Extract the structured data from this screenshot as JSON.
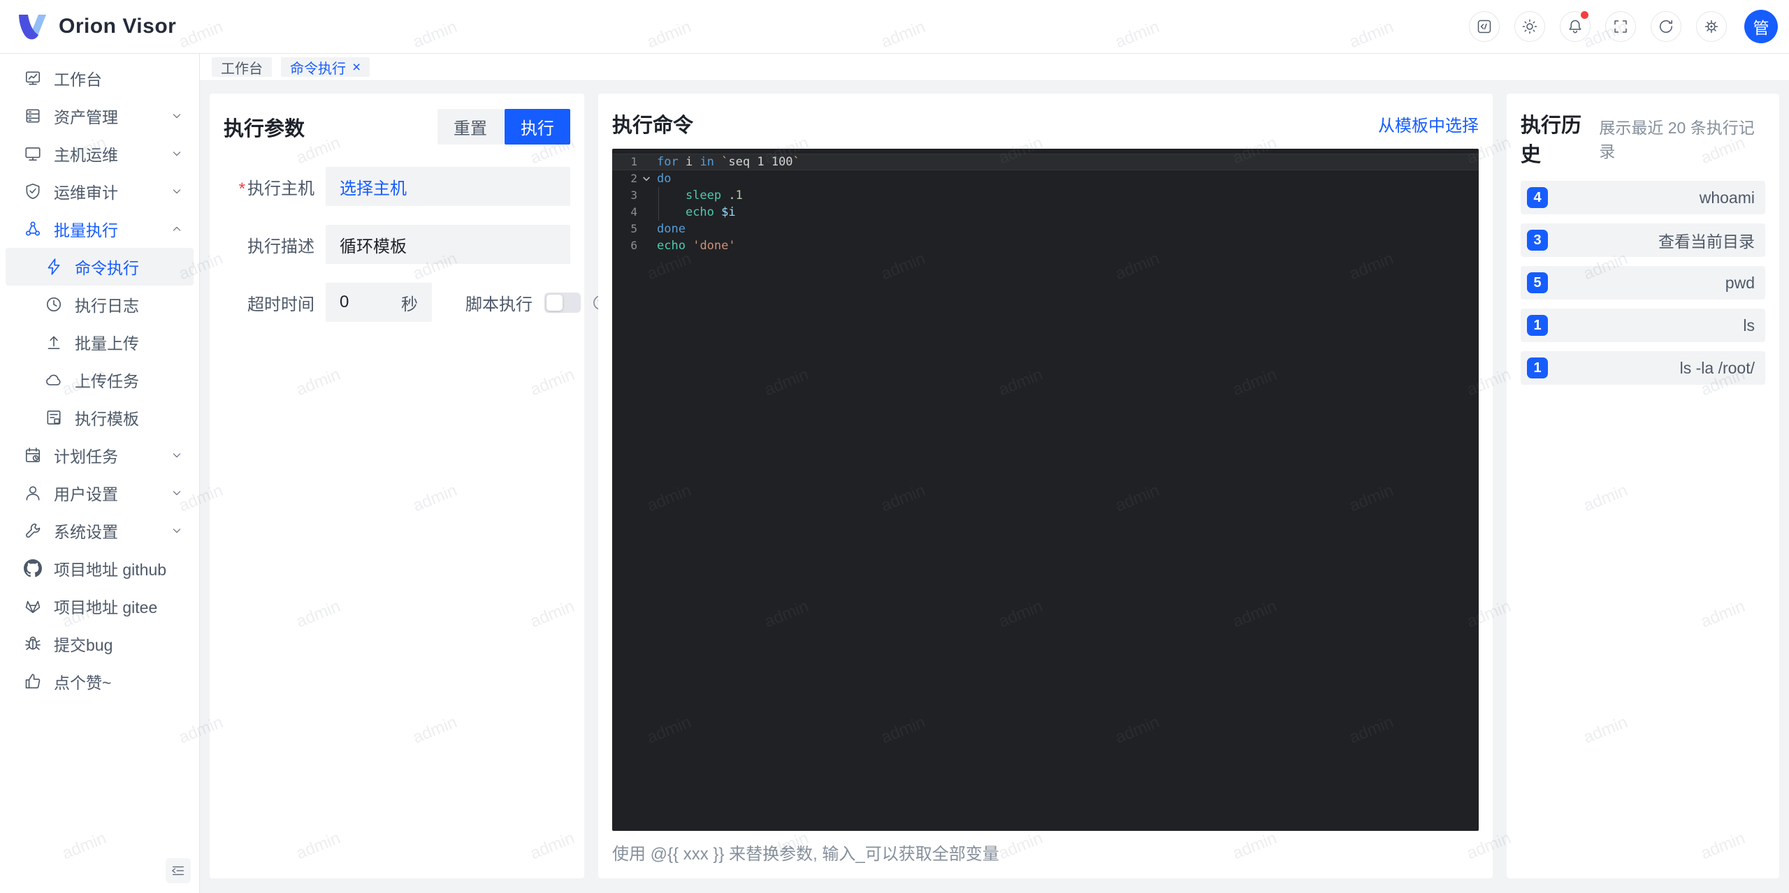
{
  "app": {
    "title": "Orion Visor"
  },
  "header": {
    "icons": [
      {
        "name": "code-snippet-icon",
        "glyph": "code"
      },
      {
        "name": "theme-icon",
        "glyph": "sun"
      },
      {
        "name": "notifications-icon",
        "glyph": "bell",
        "badge": true
      },
      {
        "name": "fullscreen-icon",
        "glyph": "fullscreen"
      },
      {
        "name": "refresh-icon",
        "glyph": "refresh"
      },
      {
        "name": "settings-icon",
        "glyph": "gear"
      }
    ],
    "avatar_text": "管"
  },
  "tabs": [
    {
      "label": "工作台",
      "active": false,
      "closable": false
    },
    {
      "label": "命令执行",
      "active": true,
      "closable": true
    }
  ],
  "sidebar": {
    "items": [
      {
        "label": "工作台",
        "icon": "dashboard"
      },
      {
        "label": "资产管理",
        "icon": "server",
        "expandable": true
      },
      {
        "label": "主机运维",
        "icon": "monitor",
        "expandable": true
      },
      {
        "label": "运维审计",
        "icon": "shield",
        "expandable": true
      },
      {
        "label": "批量执行",
        "icon": "cluster",
        "expandable": true,
        "expanded": true,
        "active": true,
        "children": [
          {
            "label": "命令执行",
            "icon": "lightning",
            "active": true
          },
          {
            "label": "执行日志",
            "icon": "clock"
          },
          {
            "label": "批量上传",
            "icon": "upload"
          },
          {
            "label": "上传任务",
            "icon": "cloud"
          },
          {
            "label": "执行模板",
            "icon": "template"
          }
        ]
      },
      {
        "label": "计划任务",
        "icon": "calendar",
        "expandable": true
      },
      {
        "label": "用户设置",
        "icon": "user",
        "expandable": true
      },
      {
        "label": "系统设置",
        "icon": "wrench",
        "expandable": true
      },
      {
        "label": "项目地址 github",
        "icon": "github"
      },
      {
        "label": "项目地址 gitee",
        "icon": "gitee"
      },
      {
        "label": "提交bug",
        "icon": "bug"
      },
      {
        "label": "点个赞~",
        "icon": "thumbsup"
      }
    ]
  },
  "params_panel": {
    "title": "执行参数",
    "reset_label": "重置",
    "run_label": "执行",
    "fields": [
      {
        "label": "执行主机",
        "required": true,
        "value": "选择主机",
        "type": "link"
      },
      {
        "label": "执行描述",
        "value": "循环模板"
      },
      {
        "label": "超时时间",
        "value": "0",
        "suffix": "秒"
      }
    ],
    "script_toggle_label": "脚本执行",
    "script_toggle_on": false
  },
  "command_panel": {
    "title": "执行命令",
    "template_link": "从模板中选择",
    "hint": "使用 @{{ xxx }} 来替换参数, 输入_可以获取全部变量",
    "code_lines": [
      {
        "n": "1",
        "current": true,
        "tokens": [
          [
            "kw",
            "for"
          ],
          [
            "pl",
            " i "
          ],
          [
            "kw",
            "in"
          ],
          [
            "pl",
            " "
          ],
          [
            "tick",
            "`"
          ],
          [
            "pl",
            "seq 1 100"
          ],
          [
            "tick",
            "`"
          ]
        ]
      },
      {
        "n": "2",
        "fold": true,
        "tokens": [
          [
            "kw",
            "do"
          ]
        ]
      },
      {
        "n": "3",
        "guide": true,
        "tokens": [
          [
            "pl",
            "    "
          ],
          [
            "fn",
            "sleep"
          ],
          [
            "pl",
            " ."
          ],
          [
            "num",
            "1"
          ]
        ]
      },
      {
        "n": "4",
        "guide": true,
        "tokens": [
          [
            "pl",
            "    "
          ],
          [
            "fn",
            "echo"
          ],
          [
            "pl",
            " "
          ],
          [
            "var",
            "$i"
          ]
        ]
      },
      {
        "n": "5",
        "tokens": [
          [
            "kw",
            "done"
          ]
        ]
      },
      {
        "n": "6",
        "tokens": [
          [
            "fn",
            "echo"
          ],
          [
            "pl",
            " "
          ],
          [
            "str",
            "'done'"
          ]
        ]
      }
    ]
  },
  "history_panel": {
    "title": "执行历史",
    "subtitle": "展示最近 20 条执行记录",
    "items": [
      {
        "count": "4",
        "command": "whoami"
      },
      {
        "count": "3",
        "command": "查看当前目录"
      },
      {
        "count": "5",
        "command": "pwd"
      },
      {
        "count": "1",
        "command": "ls"
      },
      {
        "count": "1",
        "command": "ls -la /root/"
      }
    ]
  },
  "watermark": {
    "text": "admin"
  },
  "colors": {
    "primary": "#165dff",
    "danger": "#f53f3f",
    "editor_bg": "#202124",
    "page_bg": "#f2f3f5"
  }
}
